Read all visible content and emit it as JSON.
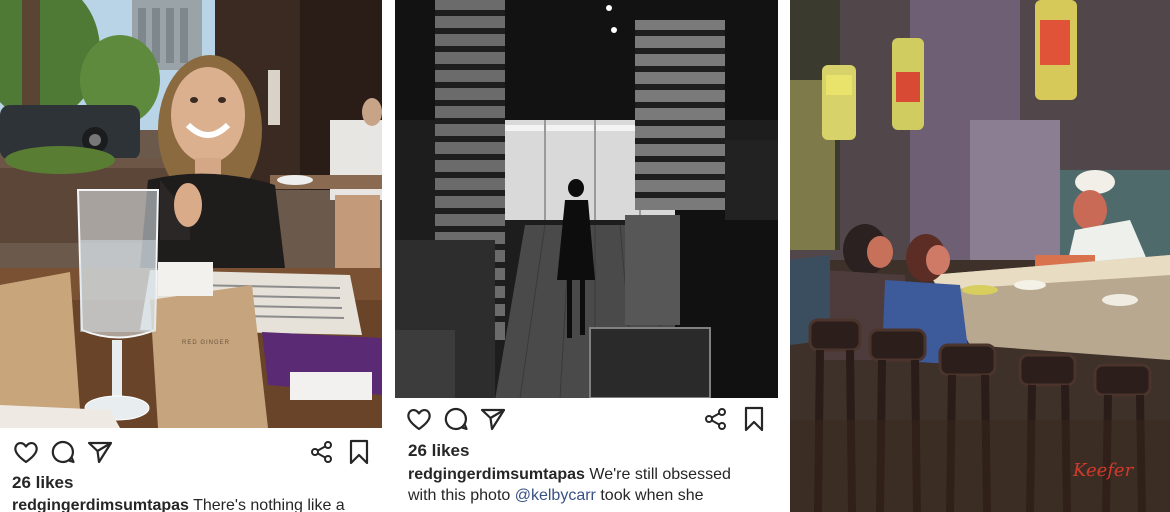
{
  "posts": [
    {
      "photo_alt": "Diner at Red Ginger with menus and water glass",
      "likes": "26 likes",
      "username": "redgingerdimsumtapas",
      "caption": "There's nothing like a",
      "menu_logo": "RED GINGER"
    },
    {
      "photo_alt": "Black and white interior of restaurant with woman walking",
      "likes": "26 likes",
      "username": "redgingerdimsumtapas",
      "caption_part1": "We're still obsessed",
      "caption_part2": "with this photo",
      "mention": "@kelbycarr",
      "caption_part3": "took when she"
    },
    {
      "photo_alt": "Oil painting of diners at a sushi bar with chef",
      "signature": "Keefer"
    }
  ],
  "icons": {
    "like": "heart-icon",
    "comment": "comment-icon",
    "share": "send-icon",
    "share_alt": "share-icon",
    "save": "bookmark-icon"
  },
  "colors": {
    "text": "#262626",
    "mention": "#385185"
  }
}
